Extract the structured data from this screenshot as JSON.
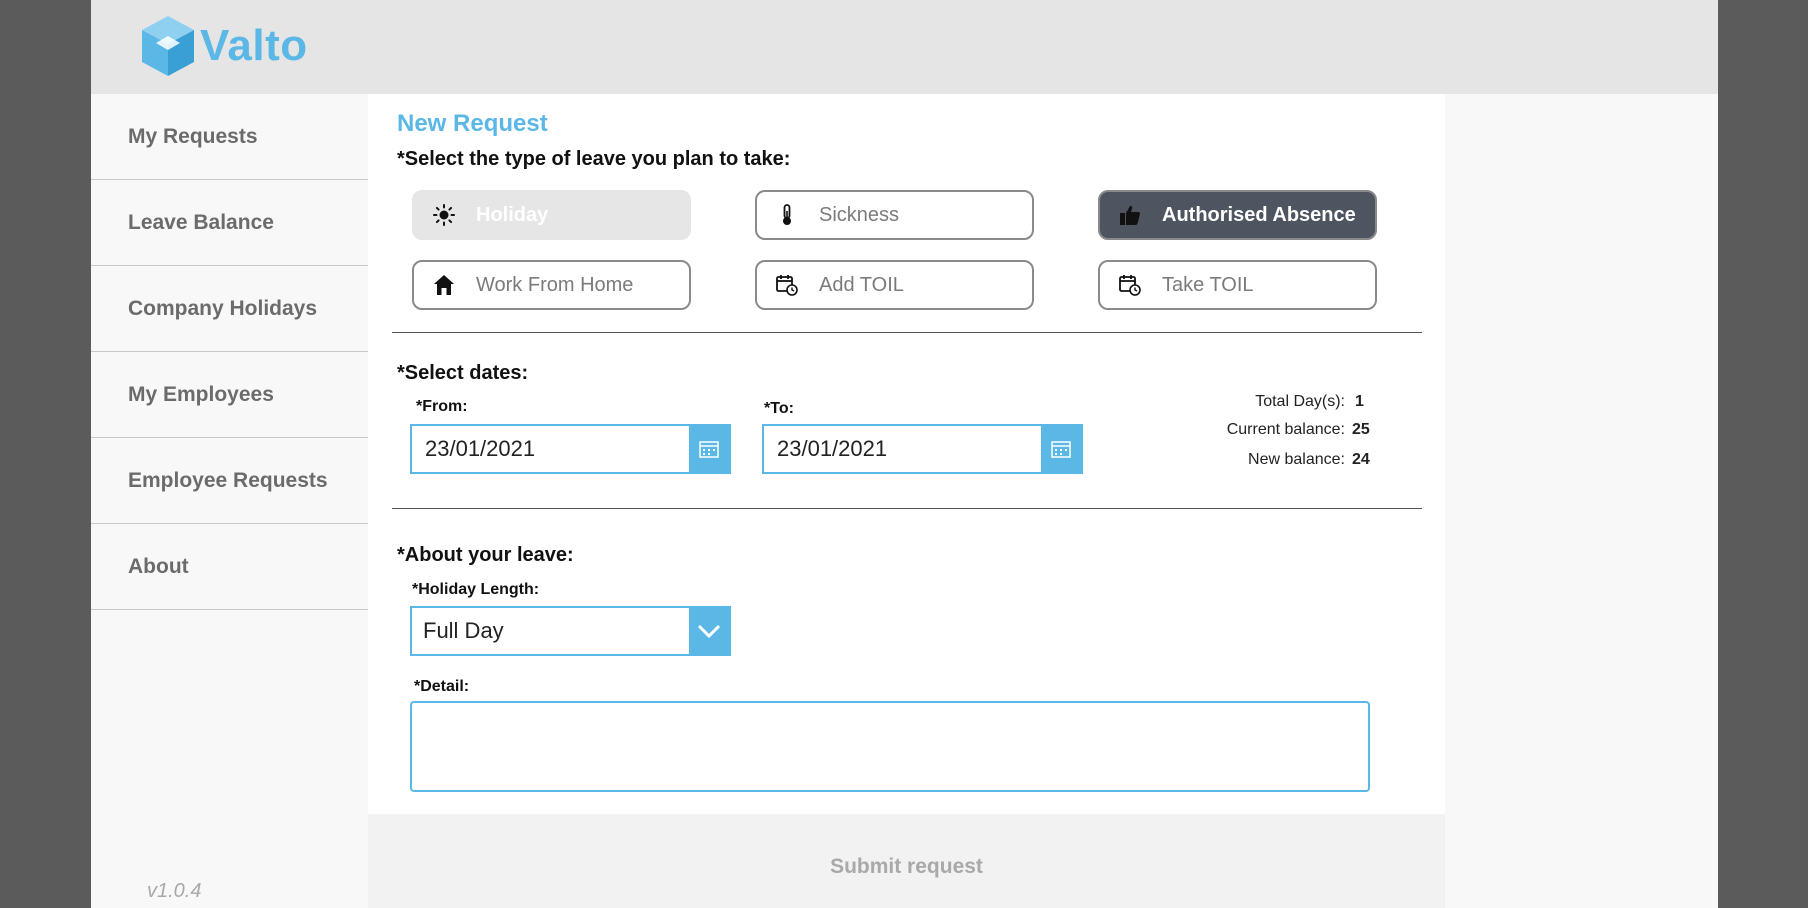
{
  "app": {
    "name": "Valto",
    "version": "v1.0.4",
    "accent": "#5bb8e6"
  },
  "sidebar": {
    "items": [
      {
        "label": "My Requests"
      },
      {
        "label": "Leave Balance"
      },
      {
        "label": "Company Holidays"
      },
      {
        "label": "My Employees"
      },
      {
        "label": "Employee Requests"
      },
      {
        "label": "About"
      }
    ]
  },
  "form": {
    "title": "New Request",
    "type_prompt": "*Select the type of leave you plan to take:",
    "leave_types": [
      {
        "label": "Holiday",
        "icon": "sun-icon",
        "state": "disabled"
      },
      {
        "label": "Sickness",
        "icon": "thermometer-icon",
        "state": "normal"
      },
      {
        "label": "Authorised Absence",
        "icon": "thumbs-up-icon",
        "state": "selected"
      },
      {
        "label": "Work From Home",
        "icon": "home-icon",
        "state": "normal"
      },
      {
        "label": "Add TOIL",
        "icon": "calendar-clock-icon",
        "state": "normal"
      },
      {
        "label": "Take TOIL",
        "icon": "calendar-clock-icon",
        "state": "normal"
      }
    ],
    "dates_prompt": "*Select dates:",
    "from_label": "*From:",
    "from_value": "23/01/2021",
    "to_label": "*To:",
    "to_value": "23/01/2021",
    "summary": {
      "total_label": "Total Day(s):",
      "total_value": "1",
      "current_label": "Current balance:",
      "current_value": "25",
      "new_label": "New balance:",
      "new_value": "24"
    },
    "about_prompt": "*About your leave:",
    "length_label": "*Holiday Length:",
    "length_value": "Full Day",
    "detail_label": "*Detail:",
    "detail_value": "",
    "submit_label": "Submit request"
  }
}
